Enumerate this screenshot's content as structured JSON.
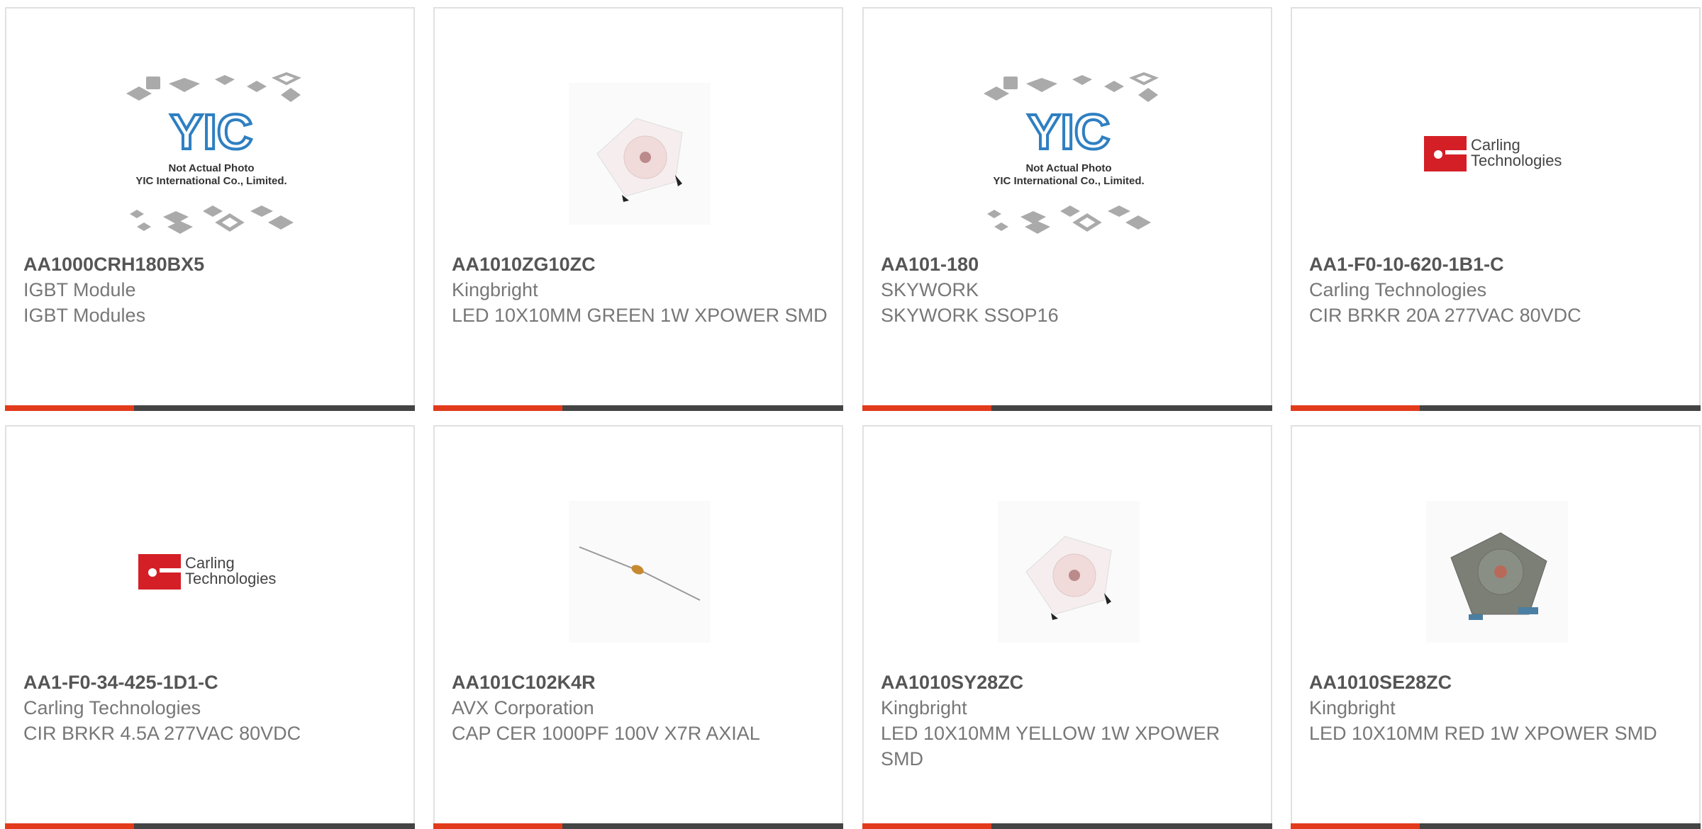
{
  "cards": [
    {
      "part_number": "AA1000CRH180BX5",
      "manufacturer": "IGBT Module",
      "description": "IGBT Modules",
      "image": "yic-not-actual-photo",
      "image_text": [
        "Not Actual Photo",
        "YIC International Co., Limited."
      ]
    },
    {
      "part_number": "AA1010ZG10ZC",
      "manufacturer": "Kingbright",
      "description": "LED 10X10MM GREEN 1W XPOWER SMD",
      "image": "led-white-smd"
    },
    {
      "part_number": "AA101-180",
      "manufacturer": "SKYWORK",
      "description": "SKYWORK SSOP16",
      "image": "yic-not-actual-photo",
      "image_text": [
        "Not Actual Photo",
        "YIC International Co., Limited."
      ]
    },
    {
      "part_number": "AA1-F0-10-620-1B1-C",
      "manufacturer": "Carling Technologies",
      "description": "CIR BRKR 20A 277VAC 80VDC",
      "image": "carling-logo",
      "logo_text": [
        "Carling",
        "Technologies"
      ]
    },
    {
      "part_number": "AA1-F0-34-425-1D1-C",
      "manufacturer": "Carling Technologies",
      "description": "CIR BRKR 4.5A 277VAC 80VDC",
      "image": "carling-logo",
      "logo_text": [
        "Carling",
        "Technologies"
      ]
    },
    {
      "part_number": "AA101C102K4R",
      "manufacturer": "AVX Corporation",
      "description": "CAP CER 1000PF 100V X7R AXIAL",
      "image": "axial-capacitor"
    },
    {
      "part_number": "AA1010SY28ZC",
      "manufacturer": "Kingbright",
      "description": "LED 10X10MM YELLOW 1W XPOWER SMD",
      "image": "led-white-smd"
    },
    {
      "part_number": "AA1010SE28ZC",
      "manufacturer": "Kingbright",
      "description": "LED 10X10MM RED 1W XPOWER SMD",
      "image": "led-gray-smd"
    }
  ],
  "colors": {
    "accent": "#e23b1c",
    "bar": "#444444",
    "part_number": "#555555",
    "text": "#777777",
    "border": "#e1e1e1"
  }
}
